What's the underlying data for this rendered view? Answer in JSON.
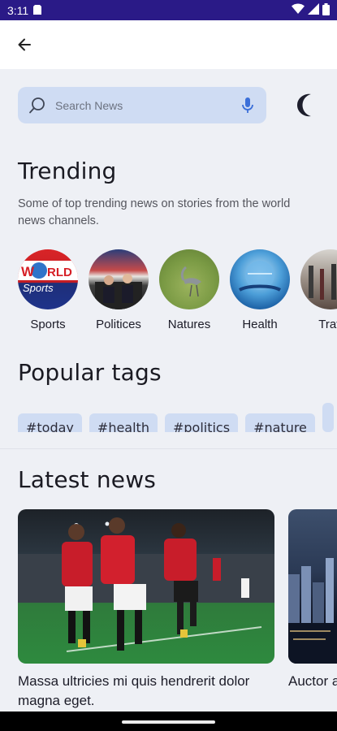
{
  "status_bar": {
    "time": "3:11"
  },
  "search": {
    "placeholder": "Search News"
  },
  "trending": {
    "title": "Trending",
    "description": "Some of top trending news on stories from the world news channels.",
    "items": [
      {
        "label": "Sports"
      },
      {
        "label": "Politices"
      },
      {
        "label": "Natures"
      },
      {
        "label": "Health"
      },
      {
        "label": "Trav"
      }
    ]
  },
  "popular_tags": {
    "title": "Popular tags",
    "tags": [
      "#today",
      "#health",
      "#politics",
      "#nature",
      ""
    ]
  },
  "latest_news": {
    "title": "Latest news",
    "items": [
      {
        "title": "Massa ultricies mi quis hendrerit dolor magna eget."
      },
      {
        "title": "Auctor amet n"
      }
    ]
  },
  "colors": {
    "status_bar": "#2a1a87",
    "chip_bg": "#cfdcf3",
    "page_bg": "#eef0f5",
    "accent": "#3b6fd9"
  }
}
